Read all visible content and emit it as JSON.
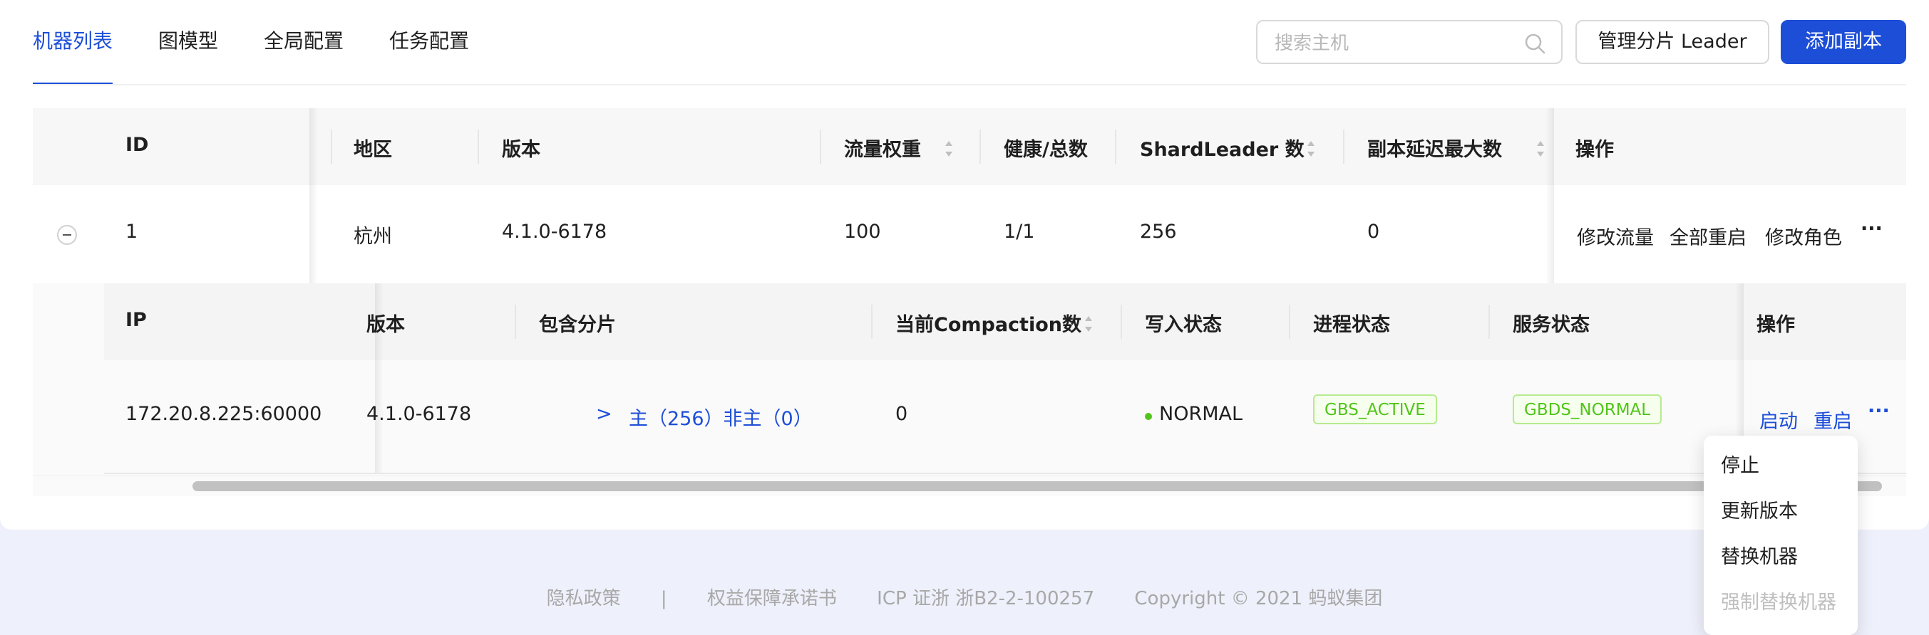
{
  "tabs": [
    {
      "label": "机器列表",
      "active": true
    },
    {
      "label": "图模型",
      "active": false
    },
    {
      "label": "全局配置",
      "active": false
    },
    {
      "label": "任务配置",
      "active": false
    }
  ],
  "toolbar": {
    "search_placeholder": "搜索主机",
    "manage_leader_label": "管理分片 Leader",
    "add_replica_label": "添加副本"
  },
  "outer_table": {
    "headers": {
      "id": "ID",
      "region": "地区",
      "version": "版本",
      "traffic_weight": "流量权重",
      "health_total": "健康/总数",
      "shard_leader": "ShardLeader 数",
      "replica_delay": "副本延迟最大数",
      "ops": "操作"
    },
    "rows": [
      {
        "id": "1",
        "region": "杭州",
        "version": "4.1.0-6178",
        "traffic_weight": "100",
        "health_total": "1/1",
        "shard_leader": "256",
        "replica_delay": "0",
        "actions": {
          "modify_traffic": "修改流量",
          "restart_all": "全部重启",
          "modify_role": "修改角色",
          "more": "···"
        }
      }
    ]
  },
  "nested_table": {
    "headers": {
      "ip": "IP",
      "version": "版本",
      "shards": "包含分片",
      "compaction": "当前Compaction数",
      "write_status": "写入状态",
      "process_status": "进程状态",
      "service_status": "服务状态",
      "ops": "操作"
    },
    "rows": [
      {
        "ip": "172.20.8.225:60000",
        "version": "4.1.0-6178",
        "shards_chevron": ">",
        "shards": "主（256）非主（0）",
        "compaction": "0",
        "write_status": "NORMAL",
        "process_status": "GBS_ACTIVE",
        "service_status": "GBDS_NORMAL",
        "actions": {
          "start": "启动",
          "restart": "重启",
          "more": "···"
        }
      }
    ]
  },
  "more_menu": {
    "items": [
      {
        "label": "停止",
        "disabled": false
      },
      {
        "label": "更新版本",
        "disabled": false
      },
      {
        "label": "替换机器",
        "disabled": false
      },
      {
        "label": "强制替换机器",
        "disabled": true
      }
    ]
  },
  "footer": {
    "privacy": "隐私政策",
    "separator": "|",
    "rights": "权益保障承诺书",
    "icp": "ICP 证浙 浙B2-2-100257",
    "copyright": "Copyright © 2021 蚂蚁集团"
  },
  "colors": {
    "primary": "#1d4ed8",
    "success": "#52c41a",
    "page_bg": "#eef0fb"
  },
  "icons": {
    "search": "search-icon",
    "expand": "minus-circle-icon",
    "sort": "sort-icon",
    "more": "ellipsis-icon"
  }
}
